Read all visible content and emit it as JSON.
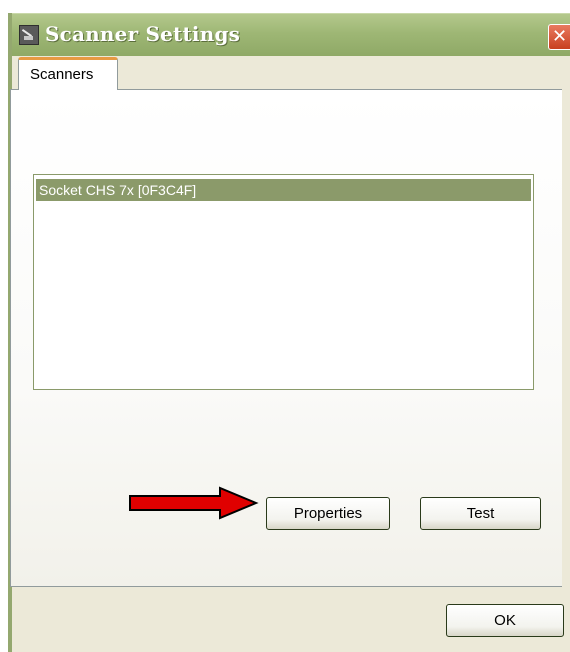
{
  "window": {
    "title": "Scanner Settings",
    "close_label": "✕"
  },
  "tabs": [
    {
      "label": "Scanners",
      "active": true
    }
  ],
  "scanner_list": {
    "items": [
      {
        "label": "Socket CHS 7x [0F3C4F]",
        "selected": true
      }
    ]
  },
  "buttons": {
    "properties_label": "Properties",
    "test_label": "Test",
    "ok_label": "OK"
  },
  "annotation": {
    "arrow_color": "#e00000",
    "points_to": "Properties"
  },
  "colors": {
    "titlebar": "#9eb775",
    "selection": "#8b9a6a",
    "tab_accent": "#e79a43"
  }
}
